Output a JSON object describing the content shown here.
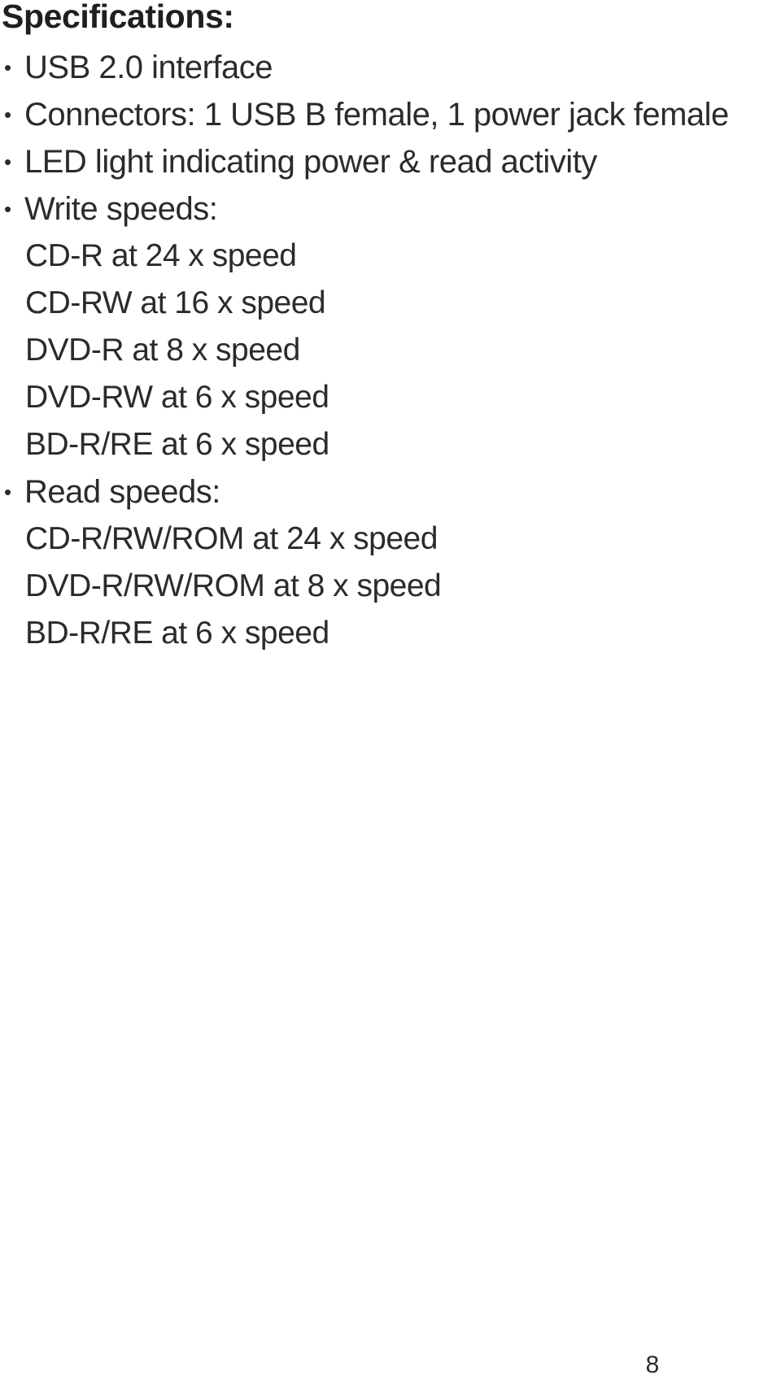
{
  "document": {
    "heading": "Specifications:",
    "page_number": "8",
    "text_color": "#2b2b2b",
    "background_color": "#ffffff",
    "bullet_glyph": "•"
  },
  "spec_lines": [
    {
      "kind": "bullet",
      "marker": "•",
      "text": "USB 2.0 interface"
    },
    {
      "kind": "bullet",
      "marker": "•",
      "text": "Connectors: 1 USB B female, 1 power jack female"
    },
    {
      "kind": "bullet",
      "marker": "•",
      "text": "LED light indicating power & read activity"
    },
    {
      "kind": "bullet",
      "marker": "•",
      "text": "Write speeds:"
    },
    {
      "kind": "sub",
      "marker": "",
      "text": "CD-R at 24 x speed"
    },
    {
      "kind": "sub",
      "marker": "",
      "text": "CD-RW at 16 x speed"
    },
    {
      "kind": "sub",
      "marker": "",
      "text": "DVD-R at 8 x speed"
    },
    {
      "kind": "sub",
      "marker": "",
      "text": "DVD-RW at 6 x speed"
    },
    {
      "kind": "sub",
      "marker": "",
      "text": "BD-R/RE at 6 x speed"
    },
    {
      "kind": "bullet",
      "marker": "•",
      "text": "Read speeds:"
    },
    {
      "kind": "sub",
      "marker": "",
      "text": "CD-R/RW/ROM at 24 x speed"
    },
    {
      "kind": "sub",
      "marker": "",
      "text": "DVD-R/RW/ROM at 8 x speed"
    },
    {
      "kind": "sub",
      "marker": "",
      "text": "BD-R/RE at 6 x speed"
    }
  ]
}
